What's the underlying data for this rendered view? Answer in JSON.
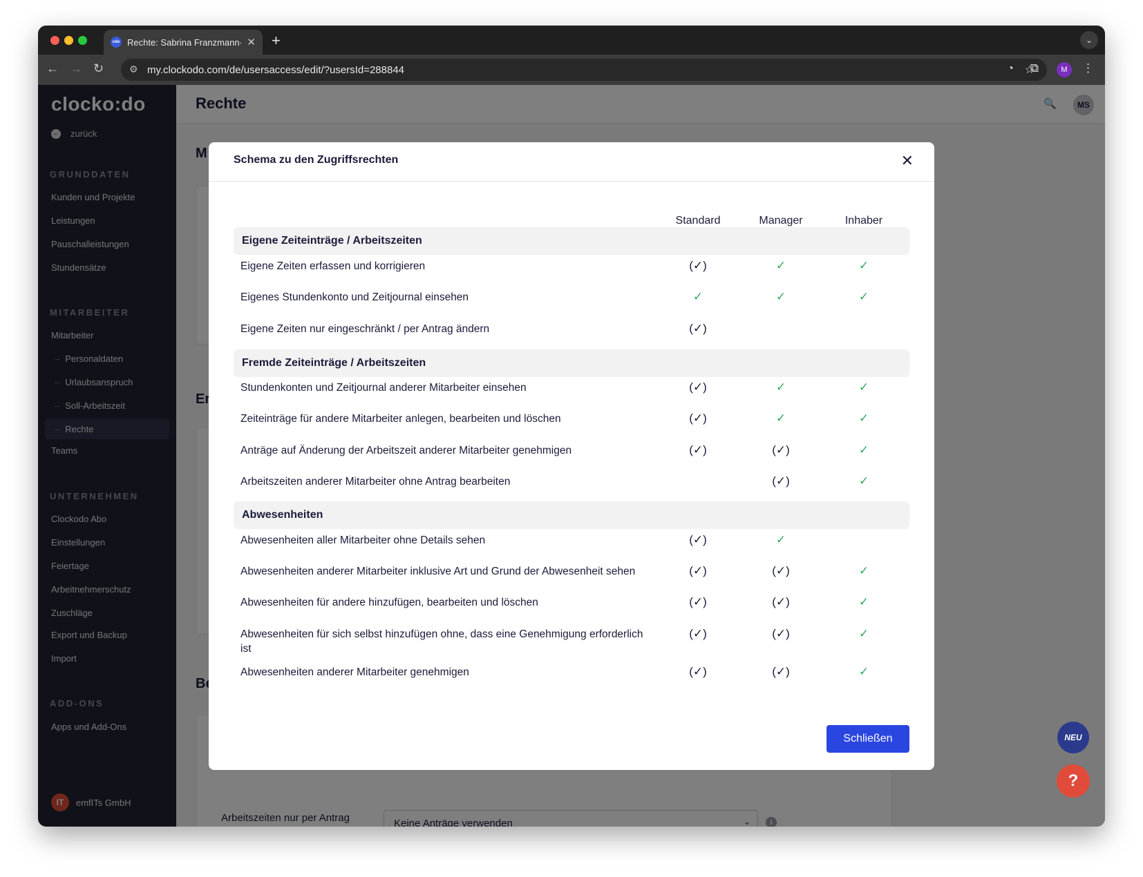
{
  "browser": {
    "tab_title": "Rechte: Sabrina Franzmann-R",
    "favicon_text": "cdo",
    "url": "my.clockodo.com/de/usersaccess/edit/?usersId=288844",
    "profile_initial": "M"
  },
  "app": {
    "logo": "clocko:do",
    "back_label": "zurück",
    "page_title": "Rechte",
    "avatar_initials": "MS",
    "company": "emfITs GmbH",
    "company_logo": "IT"
  },
  "sidebar": {
    "sections": [
      {
        "title": "GRUNDDATEN",
        "items": [
          "Kunden und Projekte",
          "Leistungen",
          "Pauschalleistungen",
          "Stundensätze"
        ]
      },
      {
        "title": "MITARBEITER",
        "items": [
          "Mitarbeiter",
          "Personaldaten",
          "Urlaubsanspruch",
          "Soll-Arbeitszeit",
          "Rechte",
          "Teams"
        ]
      },
      {
        "title": "UNTERNEHMEN",
        "items": [
          "Clockodo Abo",
          "Einstellungen",
          "Feiertage",
          "Arbeitnehmerschutz",
          "Zuschläge",
          "Export und Backup",
          "Import"
        ]
      },
      {
        "title": "ADD-ONS",
        "items": [
          "Apps und Add-Ons"
        ]
      }
    ]
  },
  "background": {
    "fragment_1": "M",
    "fragment_2": "Er",
    "fragment_3": "Be",
    "field_label": "Arbeitszeiten nur per Antrag ändern",
    "select_value": "Keine Anträge verwenden",
    "neu_badge": "NEU",
    "help_label": "?"
  },
  "modal": {
    "title": "Schema zu den Zugriffsrechten",
    "columns": [
      "Standard",
      "Manager",
      "Inhaber"
    ],
    "groups": [
      {
        "title": "Eigene Zeiteinträge / Arbeitszeiten",
        "rows": [
          {
            "label": "Eigene Zeiten erfassen und korrigieren",
            "marks": [
              "partial",
              "full",
              "full"
            ]
          },
          {
            "label": "Eigenes Stundenkonto und Zeitjournal einsehen",
            "marks": [
              "full",
              "full",
              "full"
            ]
          },
          {
            "label": "Eigene Zeiten nur eingeschränkt / per Antrag ändern",
            "marks": [
              "partial",
              "none",
              "none"
            ]
          }
        ]
      },
      {
        "title": "Fremde Zeiteinträge / Arbeitszeiten",
        "rows": [
          {
            "label": "Stundenkonten und Zeitjournal anderer Mitarbeiter einsehen",
            "marks": [
              "partial",
              "full",
              "full"
            ]
          },
          {
            "label": "Zeiteinträge für andere Mitarbeiter anlegen, bearbeiten und löschen",
            "marks": [
              "partial",
              "full",
              "full"
            ]
          },
          {
            "label": "Anträge auf Änderung der Arbeitszeit anderer Mitarbeiter genehmigen",
            "marks": [
              "partial",
              "partial",
              "full"
            ]
          },
          {
            "label": "Arbeitszeiten anderer Mitarbeiter ohne Antrag bearbeiten",
            "marks": [
              "none",
              "partial",
              "full"
            ]
          }
        ]
      },
      {
        "title": "Abwesenheiten",
        "rows": [
          {
            "label": "Abwesenheiten aller Mitarbeiter ohne Details sehen",
            "marks": [
              "partial",
              "full",
              "none"
            ]
          },
          {
            "label": "Abwesenheiten anderer Mitarbeiter inklusive Art und Grund der Abwesenheit sehen",
            "marks": [
              "partial",
              "partial",
              "full"
            ]
          },
          {
            "label": "Abwesenheiten für andere hinzufügen, bearbeiten und löschen",
            "marks": [
              "partial",
              "partial",
              "full"
            ]
          },
          {
            "label": "Abwesenheiten für sich selbst hinzufügen ohne, dass eine Genehmigung erforderlich ist",
            "marks": [
              "partial",
              "partial",
              "full"
            ]
          },
          {
            "label": "Abwesenheiten anderer Mitarbeiter genehmigen",
            "marks": [
              "partial",
              "partial",
              "full"
            ]
          }
        ]
      }
    ],
    "mark_glyphs": {
      "full": "✓",
      "partial": "(✓)",
      "none": ""
    },
    "close_button": "Schließen",
    "close_icon": "✕"
  },
  "colors": {
    "full_check": "#2eaa5c",
    "partial_check": "#f3b71e",
    "primary_button": "#2a46e0",
    "sidebar_bg": "#222233"
  }
}
